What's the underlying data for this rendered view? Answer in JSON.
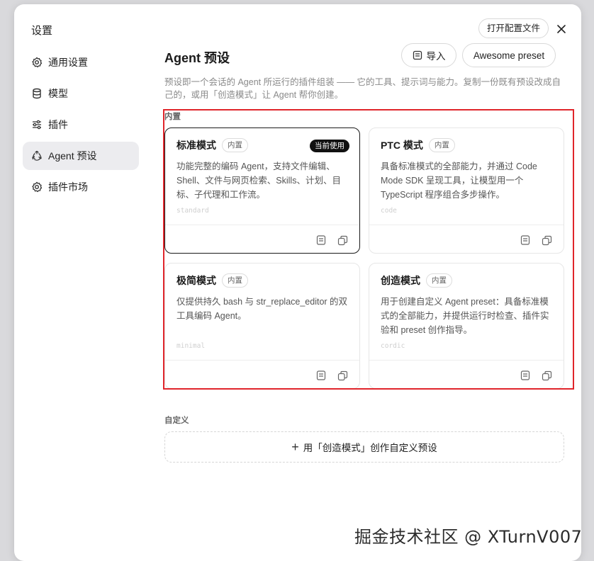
{
  "dialog": {
    "title": "设置",
    "open_config_label": "打开配置文件"
  },
  "sidebar": {
    "items": [
      {
        "label": "通用设置",
        "icon": "gear-icon"
      },
      {
        "label": "模型",
        "icon": "database-icon"
      },
      {
        "label": "插件",
        "icon": "sliders-icon"
      },
      {
        "label": "Agent 预设",
        "icon": "recycle-icon",
        "active": true
      },
      {
        "label": "插件市场",
        "icon": "gear-icon"
      }
    ]
  },
  "main": {
    "title": "Agent 预设",
    "import_label": "导入",
    "awesome_label": "Awesome preset",
    "description": "预设即一个会话的 Agent 所运行的插件组装 —— 它的工具、提示词与能力。复制一份既有预设改成自己的，或用「创造模式」让 Agent 帮你创建。",
    "builtin_section": "内置",
    "custom_section": "自定义",
    "custom_create_label": "用「创造模式」创作自定义预设",
    "current_badge": "当前使用",
    "presets": [
      {
        "name": "标准模式",
        "badge": "内置",
        "description": "功能完整的编码 Agent，支持文件编辑、Shell、文件与网页检索、Skills、计划、目标、子代理和工作流。",
        "id": "standard",
        "current": true
      },
      {
        "name": "PTC 模式",
        "badge": "内置",
        "description": "具备标准模式的全部能力，并通过 Code Mode SDK 呈现工具，让模型用一个 TypeScript 程序组合多步操作。",
        "id": "code",
        "current": false
      },
      {
        "name": "极简模式",
        "badge": "内置",
        "description": "仅提供持久 bash 与 str_replace_editor 的双工具编码 Agent。",
        "id": "minimal",
        "current": false
      },
      {
        "name": "创造模式",
        "badge": "内置",
        "description": "用于创建自定义 Agent preset：具备标准模式的全部能力，并提供运行时检查、插件实验和 preset 创作指导。",
        "id": "cordic",
        "current": false
      }
    ]
  },
  "watermark": "掘金技术社区 @ XTurnV007",
  "colors": {
    "highlight": "#e0252b",
    "current_badge_bg": "#111111",
    "active_nav_bg": "#ececef"
  }
}
